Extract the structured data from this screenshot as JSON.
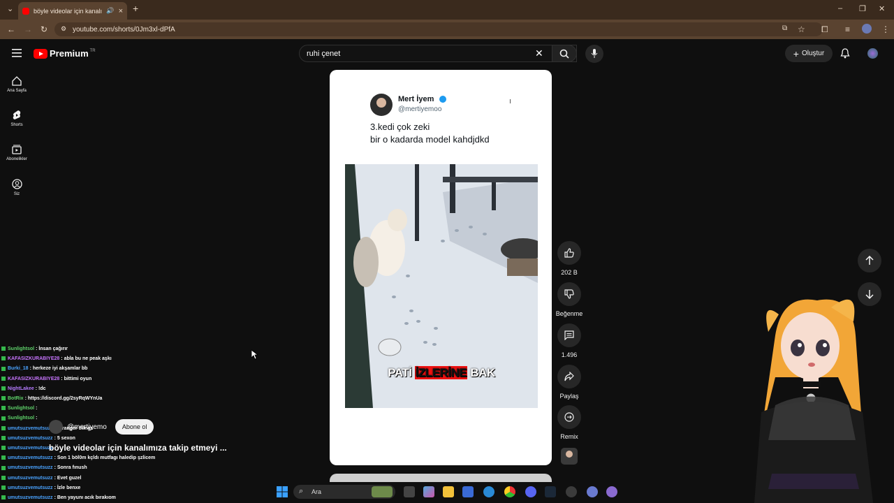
{
  "browser": {
    "tab_title": "böyle videolar için kanalımız",
    "url": "youtube.com/shorts/0Jm3xl-dPfA"
  },
  "youtube": {
    "logo_text": "Premium",
    "country": "TR",
    "search_value": "ruhi çenet",
    "create_label": "Oluştur",
    "sidebar": [
      {
        "label": "Ana Sayfa"
      },
      {
        "label": "Shorts"
      },
      {
        "label": "Abonelikler"
      },
      {
        "label": "Siz"
      }
    ]
  },
  "tweet": {
    "name": "Mert İyem",
    "handle": "@mertiyemoo",
    "line1": "3.kedi çok zeki",
    "line2": "bir o kadarda model kahdjdkd",
    "video_caption_a": "PATİ",
    "video_caption_b": "İZLERİNE",
    "video_caption_c": "BAK"
  },
  "actions": {
    "like_count": "202 B",
    "dislike_label": "Beğenme",
    "comments_count": "1.496",
    "share_label": "Paylaş",
    "remix_label": "Remix"
  },
  "channel": {
    "handle": "@mertiyemo",
    "subscribe_label": "Abone ol",
    "title": "böyle videolar için kanalımıza takip etmeyi ..."
  },
  "chat": [
    {
      "user": "Sunlightsol",
      "color": "#5fd36b",
      "msg": ": İnsan çağırır"
    },
    {
      "user": "KAFASIZKURABIYE28",
      "color": "#c875ff",
      "msg": ": abla bu ne peak aşkı"
    },
    {
      "user": "Burki_18",
      "color": "#4aa3ff",
      "msg": ": herkeze iyi akşamlar bb"
    },
    {
      "user": "KAFASIZKURABIYE28",
      "color": "#c875ff",
      "msg": ": bittimi oyun"
    },
    {
      "user": "NightLakee",
      "color": "#b57bff",
      "msg": ": !dc"
    },
    {
      "user": "BotRix",
      "color": "#5fd36b",
      "msg": ": https://discord.gg/2syRqWYnUa"
    },
    {
      "user": "Sunlightsol",
      "color": "#5fd36b",
      "msg": ":"
    },
    {
      "user": "Sunlightsol",
      "color": "#5fd36b",
      "msg": ":"
    },
    {
      "user": "umutsuzvemutsuzz",
      "color": "#4aa3ff",
      "msg": ": Stranger things"
    },
    {
      "user": "umutsuzvemutsuzz",
      "color": "#4aa3ff",
      "msg": ": 5 sexon"
    },
    {
      "user": "umutsuzvemutsuzz",
      "color": "#4aa3ff",
      "msg": ""
    },
    {
      "user": "umutsuzvemutsuzz",
      "color": "#4aa3ff",
      "msg": ": Son 1 böl0m kçldı mutfagı haledip şzlicem"
    },
    {
      "user": "umutsuzvemutsuzz",
      "color": "#4aa3ff",
      "msg": ": Sonra fınush"
    },
    {
      "user": "umutsuzvemutsuzz",
      "color": "#4aa3ff",
      "msg": ": Evet guzel"
    },
    {
      "user": "umutsuzvemutsuzz",
      "color": "#4aa3ff",
      "msg": ": İzle benxe"
    },
    {
      "user": "umutsuzvemutsuzz",
      "color": "#4aa3ff",
      "msg": ": Ben yayunı acık bırakıom"
    }
  ],
  "taskbar": {
    "search_placeholder": "Ara"
  },
  "colors": {
    "youtube_red": "#ff0000",
    "verified_blue": "#1d9bf0",
    "chrome_brown": "#3a2a1d"
  }
}
